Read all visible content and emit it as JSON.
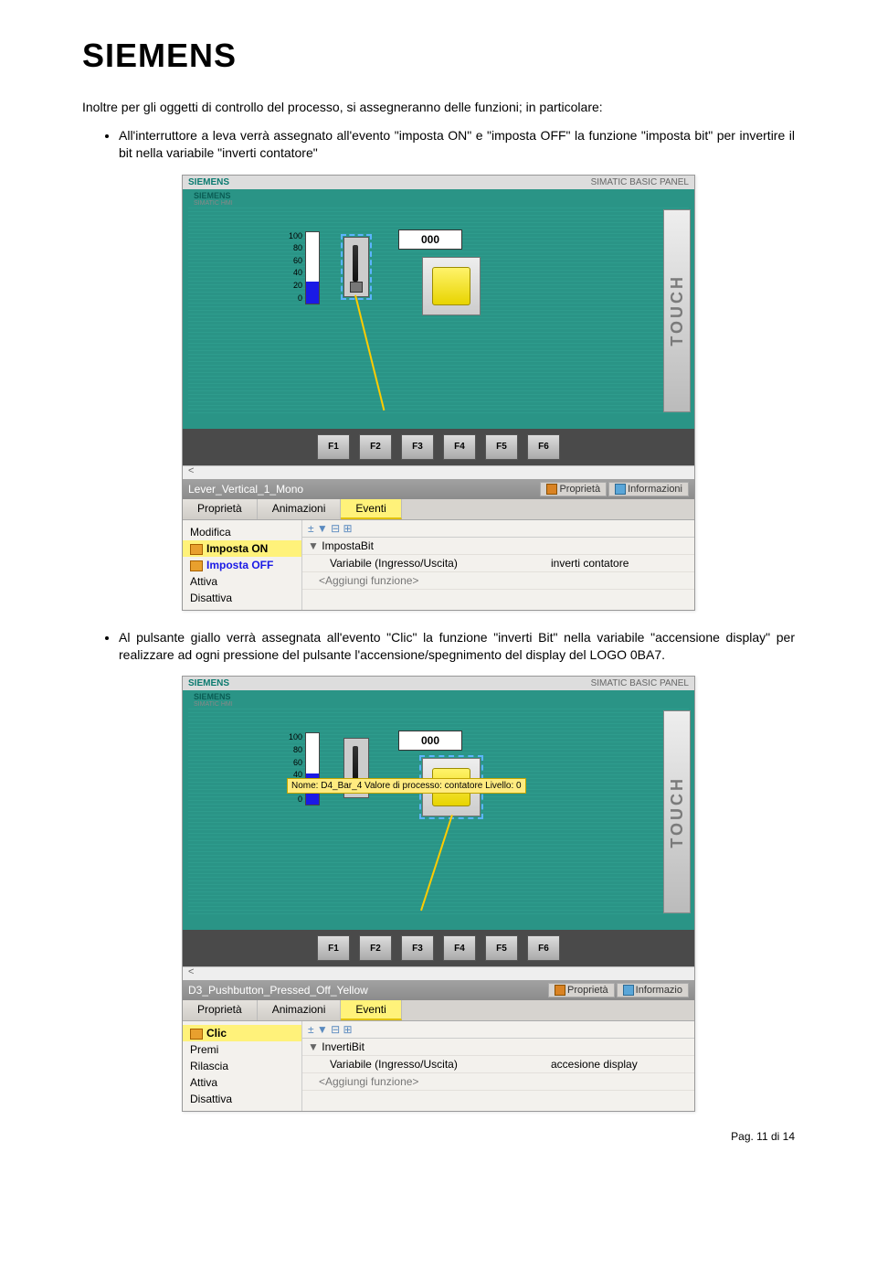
{
  "logo": "SIEMENS",
  "intro": "Inoltre per gli oggetti di controllo del processo, si assegneranno delle funzioni; in particolare:",
  "bullet1": "All'interruttore a leva verrà assegnato all'evento \"imposta ON\" e \"imposta OFF\" la funzione \"imposta bit\" per invertire il bit nella variabile \"inverti contatore\"",
  "bullet2": "Al pulsante giallo verrà assegnata all'evento \"Clic\" la funzione \"inverti Bit\" nella variabile \"accensione display\" per realizzare ad ogni pressione del pulsante l'accensione/spegnimento del display del LOGO 0BA7.",
  "panel": {
    "brand": "SIEMENS",
    "product": "SIMATIC BASIC PANEL",
    "sub": "SIEMENS",
    "sub2": "SIMATIC HMI",
    "touch": "TOUCH",
    "ticks": [
      "100",
      "80",
      "60",
      "40",
      "20",
      "0"
    ],
    "display": "000",
    "fkeys": [
      "F1",
      "F2",
      "F3",
      "F4",
      "F5",
      "F6"
    ],
    "fill1": 30,
    "fill2": 44
  },
  "tooltip2": "Nome: D4_Bar_4   Valore di processo: contatore   Livello: 0",
  "prop1": {
    "name": "Lever_Vertical_1_Mono",
    "tabs": {
      "prop": "Proprietà",
      "info": "Informazioni"
    },
    "subtabs": {
      "p": "Proprietà",
      "a": "Animazioni",
      "e": "Eventi"
    },
    "left": {
      "modifica": "Modifica",
      "on": "Imposta ON",
      "off": "Imposta OFF",
      "attiva": "Attiva",
      "disattiva": "Disattiva"
    },
    "toolbar": "±  ▼  ⊟ ⊞",
    "rows": {
      "r1a": "▼",
      "r1b": "ImpostaBit",
      "r2a": "",
      "r2b": "Variabile (Ingresso/Uscita)",
      "r2c": "inverti contatore",
      "r3b": "<Aggiungi funzione>"
    }
  },
  "prop2": {
    "name": "D3_Pushbutton_Pressed_Off_Yellow",
    "tabs": {
      "prop": "Proprietà",
      "info": "Informazio"
    },
    "subtabs": {
      "p": "Proprietà",
      "a": "Animazioni",
      "e": "Eventi"
    },
    "left": {
      "clic": "Clic",
      "premi": "Premi",
      "rilascia": "Rilascia",
      "attiva": "Attiva",
      "disattiva": "Disattiva"
    },
    "toolbar": "±  ▼  ⊟ ⊞",
    "rows": {
      "r1a": "▼",
      "r1b": "InvertiBit",
      "r2a": "",
      "r2b": "Variabile (Ingresso/Uscita)",
      "r2c": "accesione display",
      "r3b": "<Aggiungi funzione>"
    }
  },
  "footer": "Pag. 11 di 14"
}
